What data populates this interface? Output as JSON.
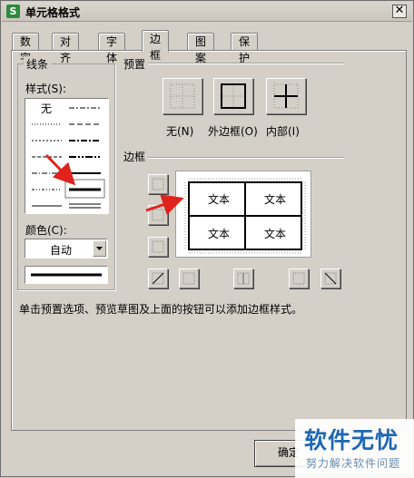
{
  "window": {
    "app_icon": "S",
    "title": "单元格格式",
    "close": "✕"
  },
  "tabs": [
    {
      "label": "数字",
      "active": false
    },
    {
      "label": "对齐",
      "active": false
    },
    {
      "label": "字体",
      "active": false
    },
    {
      "label": "边框",
      "active": true
    },
    {
      "label": "图案",
      "active": false
    },
    {
      "label": "保护",
      "active": false
    }
  ],
  "line_group": {
    "title": "线条",
    "style_label": "样式(S):",
    "none_label": "无",
    "color_label": "颜色(C):",
    "color_value": "自动"
  },
  "preset_group": {
    "title": "预置",
    "buttons": [
      {
        "label": "无(N)"
      },
      {
        "label": "外边框(O)"
      },
      {
        "label": "内部(I)"
      }
    ]
  },
  "border_group": {
    "title": "边框",
    "preview_cells": [
      "文本",
      "文本",
      "文本",
      "文本"
    ]
  },
  "hint": "单击预置选项、预览草图及上面的按钮可以添加边框样式。",
  "ok_label": "确定",
  "watermark": {
    "main": "软件无忧",
    "sub": "努力解决软件问题"
  },
  "colors": {
    "annotation_arrow": "#e0221c",
    "watermark_blue": "#1f67b3"
  },
  "icons": [
    "close-icon",
    "app-logo-icon",
    "dropdown-arrow-icon",
    "diagonal-up-icon",
    "diagonal-down-icon"
  ]
}
